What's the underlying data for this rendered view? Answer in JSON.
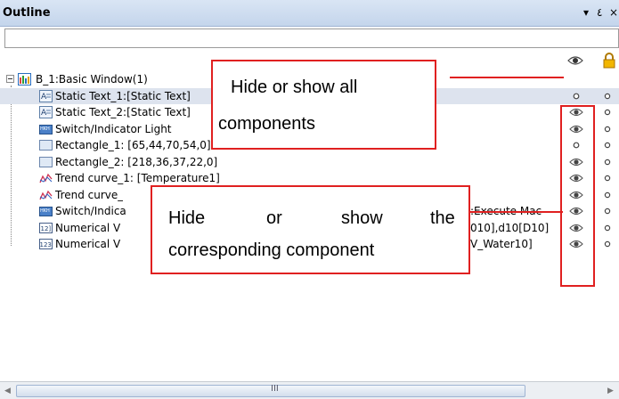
{
  "panel": {
    "title": "Outline",
    "pin_glyph": "▾",
    "dock_glyph": "٤",
    "close_glyph": "×"
  },
  "search": {
    "value": "",
    "placeholder": ""
  },
  "header_icons": [
    "eye-icon",
    "lock-icon"
  ],
  "tree": {
    "root": {
      "label": "B_1:Basic Window(1)",
      "icon": "window-icon"
    },
    "items": [
      {
        "label": "Static Text_1:[Static Text]",
        "icon": "static-text-icon",
        "visibility": "small-circle",
        "selected": true
      },
      {
        "label": "Static Text_2:[Static Text]",
        "icon": "static-text-icon",
        "visibility": "eye"
      },
      {
        "label": "Switch/Indicator Light",
        "icon": "switch-indicator-icon",
        "visibility": "eye"
      },
      {
        "label": "Rectangle_1: [65,44,70,54,0]",
        "icon": "rectangle-icon",
        "visibility": "small-circle"
      },
      {
        "label": "Rectangle_2: [218,36,37,22,0]",
        "icon": "rectangle-icon",
        "visibility": "eye"
      },
      {
        "label": "Trend curve_1: [Temperature1]",
        "icon": "trend-curve-icon",
        "visibility": "eye"
      },
      {
        "label": "Trend curve_",
        "icon": "trend-curve-icon",
        "visibility": "eye"
      },
      {
        "label": "Switch/Indica",
        "suffix": ":Execute Mac",
        "icon": "switch-indicator-icon",
        "visibility": "eye"
      },
      {
        "label": "Numerical V",
        "suffix": "010],d10[D10]",
        "icon": "numeric-input-icon",
        "visibility": "eye"
      },
      {
        "label": "Numerical V",
        "suffix": "V_Water10]",
        "icon": "numeric-display-icon",
        "visibility": "eye"
      }
    ]
  },
  "callouts": {
    "hide_all": {
      "line1": "Hide or show all",
      "line2": "components"
    },
    "hide_one": {
      "words": [
        "Hide",
        "or",
        "show",
        "the"
      ],
      "line2": "corresponding component"
    }
  },
  "scrollbar": {
    "grip": "III",
    "left_arrow": "◀",
    "right_arrow": "▶"
  },
  "colors": {
    "callout_border": "#e02020",
    "title_bg": "#c4d5ec",
    "selected_row": "#dde3ee"
  }
}
